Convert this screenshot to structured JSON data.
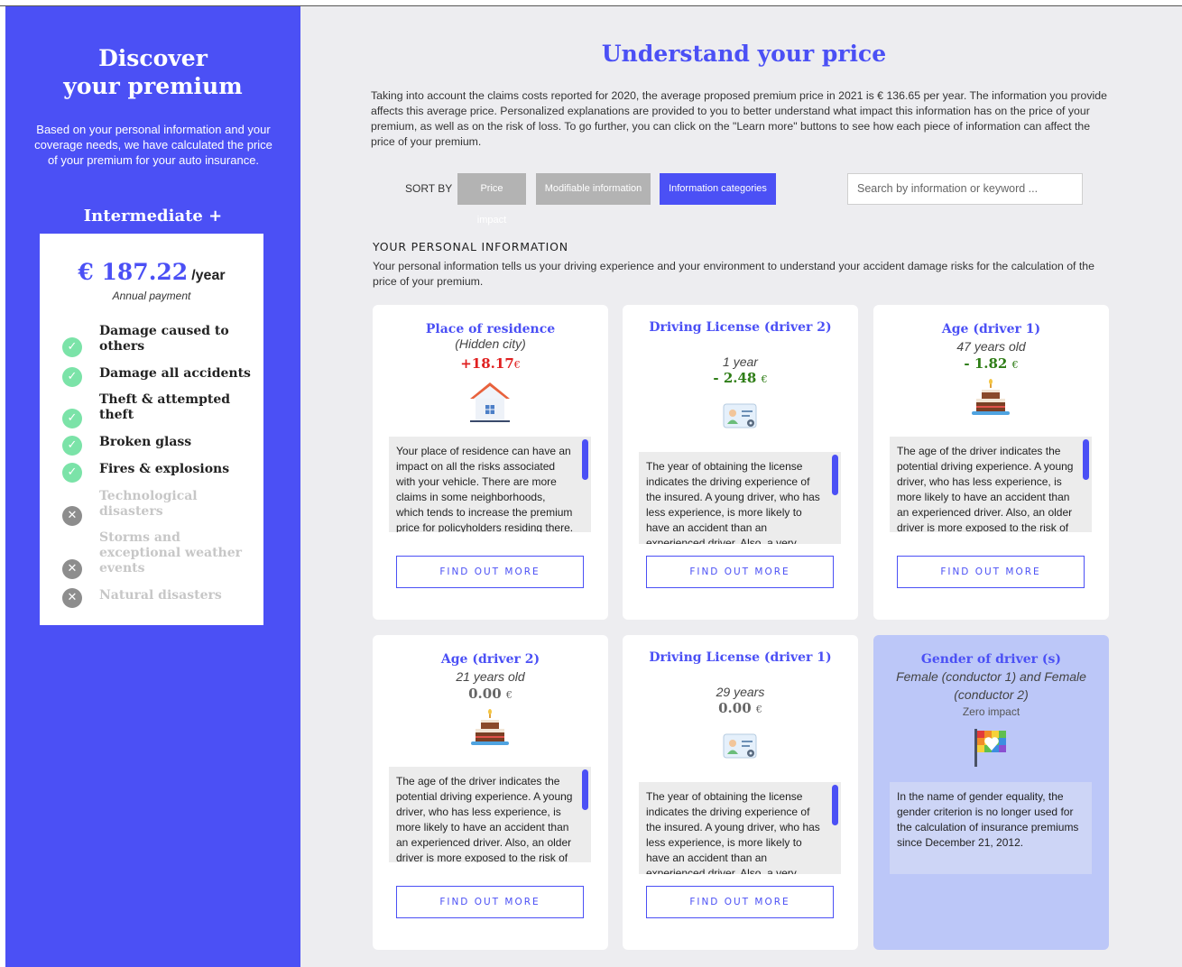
{
  "sidebar": {
    "title_line1": "Discover",
    "title_line2": "your premium",
    "description": "Based on your personal information and your coverage needs, we have calculated the price of your premium for your auto insurance.",
    "plan": "Intermediate +",
    "price_amount": "€ 187.22",
    "price_period": "/year",
    "price_note": "Annual payment",
    "coverages": [
      {
        "label": "Damage caused to others",
        "included": true
      },
      {
        "label": "Damage all accidents",
        "included": true
      },
      {
        "label": "Theft & attempted theft",
        "included": true
      },
      {
        "label": "Broken glass",
        "included": true
      },
      {
        "label": "Fires & explosions",
        "included": true
      },
      {
        "label": "Technological disasters",
        "included": false
      },
      {
        "label": "Storms and exceptional weather events",
        "included": false
      },
      {
        "label": "Natural disasters",
        "included": false
      }
    ],
    "included_icon": "check-circle-icon",
    "excluded_icon": "x-circle-icon"
  },
  "main": {
    "title": "Understand your price",
    "intro": "Taking into account the claims costs reported for 2020, the average proposed premium price in 2021 is € 136.65 per year. The information you provide affects this average price. Personalized explanations are provided to you to better understand what impact this information has on the price of your premium, as well as on the risk of loss. To go further, you can click on the \"Learn more\" buttons to see how each piece of information can affect the price of your premium.",
    "sort_label": "SORT BY",
    "sort_options": [
      "Price impact",
      "Modifiable information",
      "Information categories"
    ],
    "sort_selected": "Information categories",
    "search_placeholder": "Search by information or keyword ...",
    "section_title": "YOUR PERSONAL INFORMATION",
    "section_desc": "Your personal information tells us your driving experience and your environment to understand your accident damage risks for the calculation of the price of your premium.",
    "button_label": "FIND OUT MORE",
    "cards": [
      {
        "title": "Place of residence",
        "subtitle": "(Hidden city)",
        "impact": "+18.17",
        "currency": "€",
        "icon": "house-icon",
        "text": "Your place of residence can have an impact on all the risks associated with your vehicle. There are more claims in some neighborhoods, which tends to increase the premium price for policyholders residing there."
      },
      {
        "title": "Driving License (driver 2)",
        "subtitle": "1 year",
        "impact": "- 2.48",
        "currency": "€",
        "icon": "id-card-icon",
        "text": "The year of obtaining the license indicates the driving experience of the insured. A young driver, who has less experience, is more likely to have an accident than an experienced driver. Also, a very recent license may increase the price."
      },
      {
        "title": "Age (driver 1)",
        "subtitle": "47 years old",
        "impact": "- 1.82",
        "currency": "€",
        "icon": "birthday-cake-icon",
        "text": "The age of the driver indicates the potential driving experience. A young driver, who has less experience, is more likely to have an accident than an experienced driver. Also, an older driver is more exposed to the risk of injury."
      },
      {
        "title": "Age (driver 2)",
        "subtitle": "21 years old",
        "impact": "0.00",
        "currency": "€",
        "icon": "birthday-cake-icon",
        "text": "The age of the driver indicates the potential driving experience. A young driver, who has less experience, is more likely to have an accident than an experienced driver. Also, an older driver is more exposed to the risk of injury."
      },
      {
        "title": "Driving License (driver 1)",
        "subtitle": "29 years",
        "impact": "0.00",
        "currency": "€",
        "icon": "id-card-icon",
        "text": "The year of obtaining the license indicates the driving experience of the insured. A young driver, who has less experience, is more likely to have an accident than an experienced driver. Also, a very recent license may increase the price."
      },
      {
        "title": "Gender of driver (s)",
        "subtitle": "Female (conductor 1) and Female (conductor 2)",
        "impact_label": "Zero impact",
        "icon": "equality-flag-icon",
        "text": "In the name of gender equality, the gender criterion is no longer used for the calculation of insurance premiums since December 21, 2012."
      }
    ]
  },
  "colors": {
    "accent": "#4b50f5",
    "positive_impact": "#e01f1f",
    "negative_impact": "#2e7d16",
    "included": "#7be3a8",
    "excluded": "#8d8d8d",
    "zero_impact_card": "#bcc7f8"
  }
}
